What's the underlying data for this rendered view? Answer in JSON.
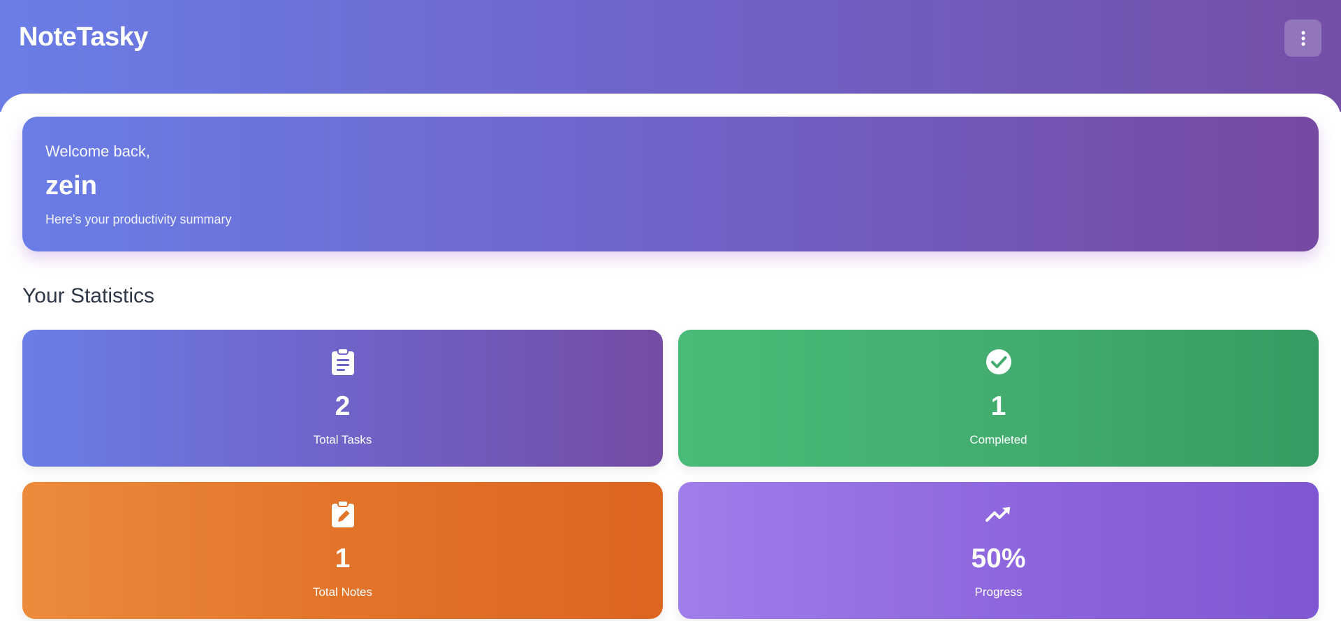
{
  "header": {
    "brand": "NoteTasky",
    "menu_icon": "more-vertical-icon"
  },
  "welcome": {
    "greeting": "Welcome back,",
    "name": "zein",
    "subtitle": "Here's your productivity summary"
  },
  "statistics": {
    "title": "Your Statistics",
    "cards": [
      {
        "icon": "clipboard-list-icon",
        "value": "2",
        "label": "Total Tasks",
        "color_start": "#6a7ee6",
        "color_end": "#744ca5"
      },
      {
        "icon": "check-circle-icon",
        "value": "1",
        "label": "Completed",
        "color_start": "#49bb78",
        "color_end": "#379c63"
      },
      {
        "icon": "clipboard-edit-icon",
        "value": "1",
        "label": "Total Notes",
        "color_start": "#ec8a3b",
        "color_end": "#dc6520"
      },
      {
        "icon": "trending-up-icon",
        "value": "50%",
        "label": "Progress",
        "color_start": "#9f7dea",
        "color_end": "#7f57d3"
      }
    ]
  }
}
